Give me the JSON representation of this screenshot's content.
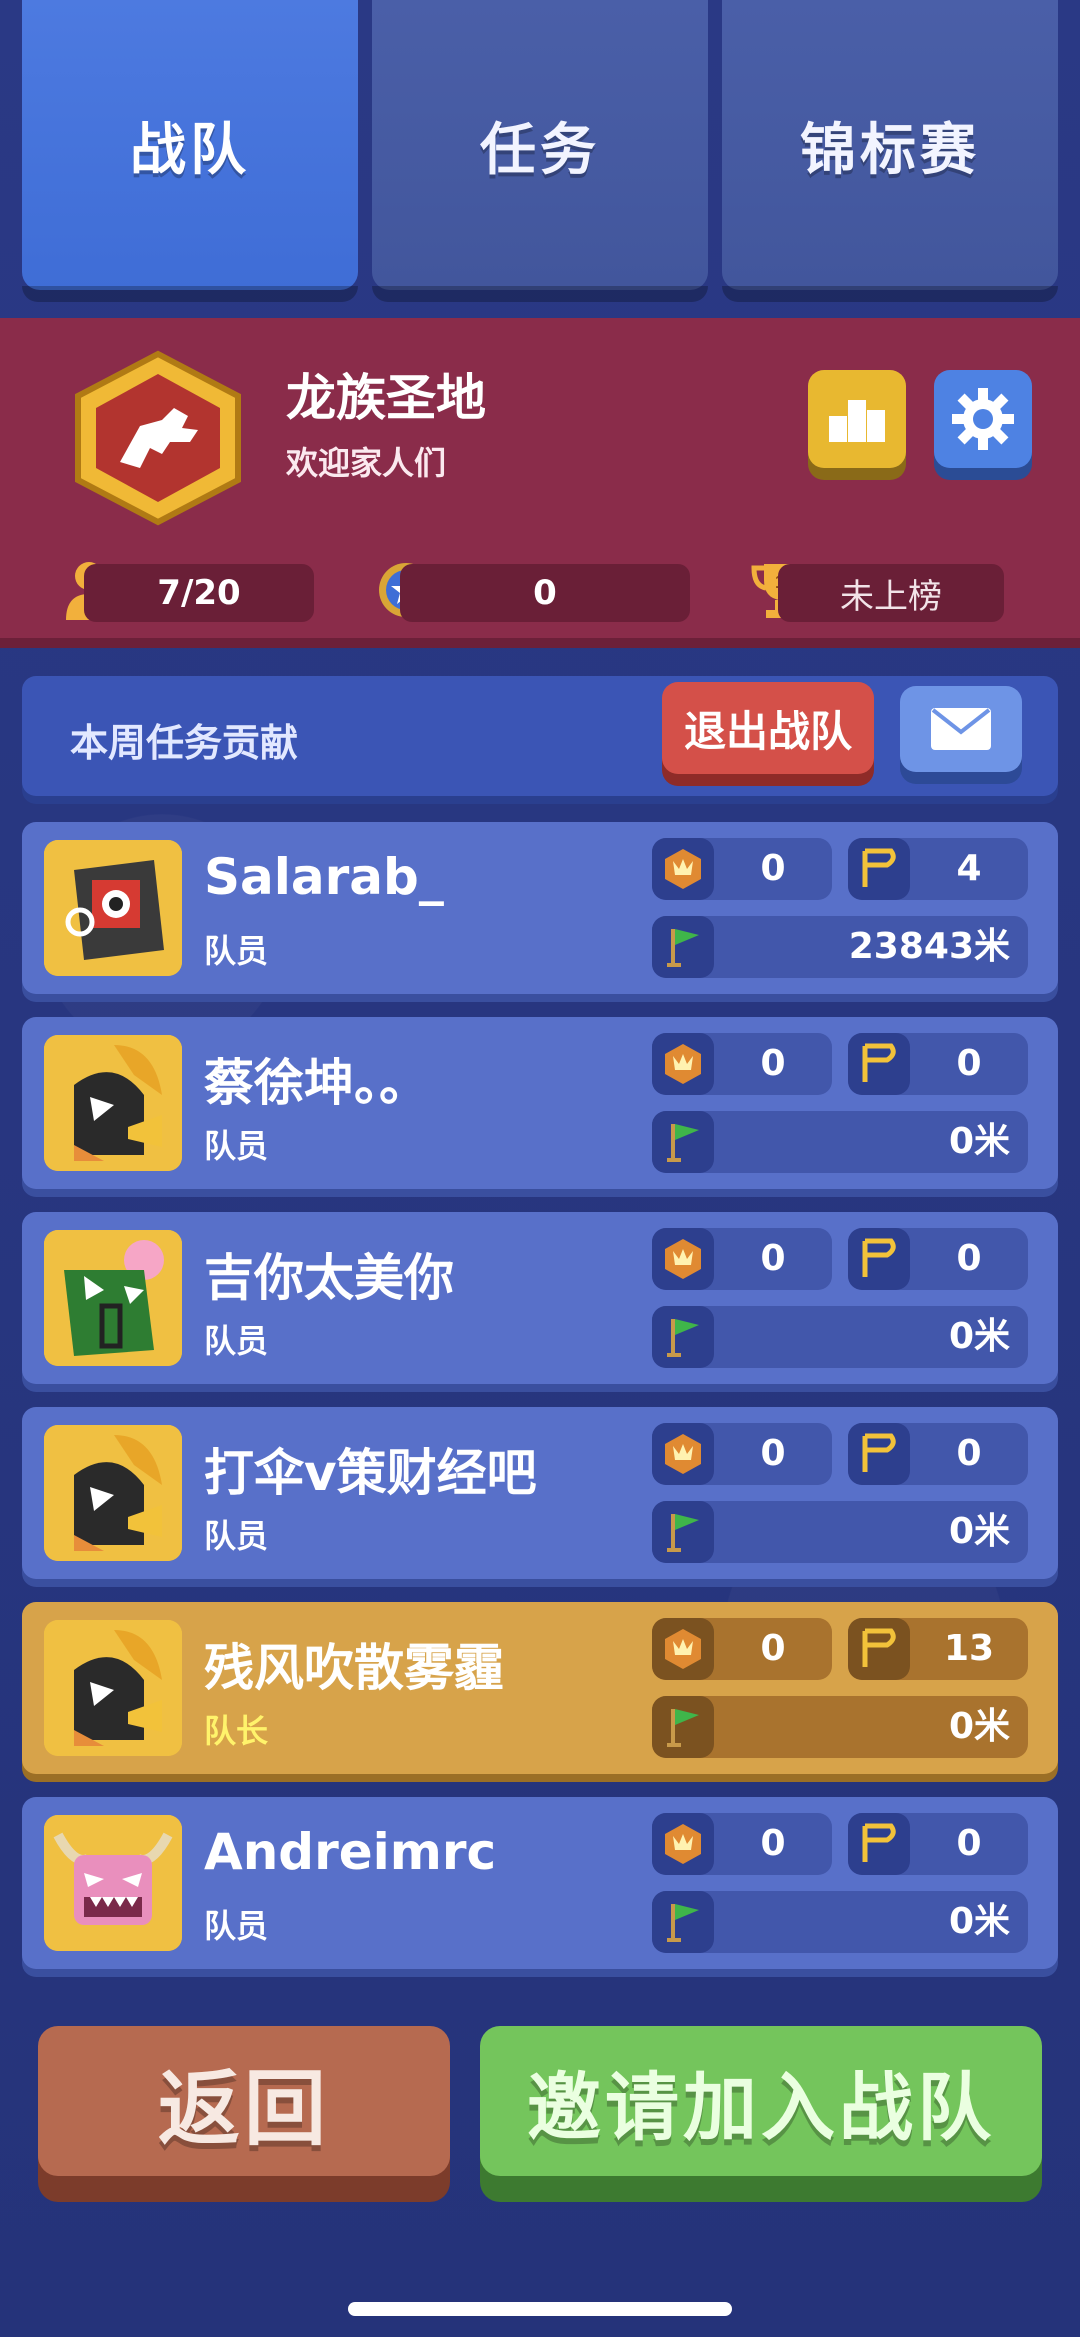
{
  "tabs": [
    {
      "label": "战队",
      "active": true
    },
    {
      "label": "任务",
      "active": false
    },
    {
      "label": "锦标赛",
      "active": false
    }
  ],
  "team": {
    "name": "龙族圣地",
    "motto": "欢迎家人们",
    "members": "7/20",
    "stars": "0",
    "rank": "未上榜"
  },
  "weekly": {
    "title": "本周任务贡献",
    "leave_label": "退出战队"
  },
  "members": [
    {
      "name": "Salarab_",
      "role": "队员",
      "trophies": "0",
      "flags": "4",
      "distance": "23843米",
      "captain": false,
      "avatar": "robot-red"
    },
    {
      "name": "蔡徐坤。。",
      "role": "队员",
      "trophies": "0",
      "flags": "0",
      "distance": "0米",
      "captain": false,
      "avatar": "penguin-horn"
    },
    {
      "name": "吉你太美你",
      "role": "队员",
      "trophies": "0",
      "flags": "0",
      "distance": "0米",
      "captain": false,
      "avatar": "green-monster"
    },
    {
      "name": "打伞v策财经吧",
      "role": "队员",
      "trophies": "0",
      "flags": "0",
      "distance": "0米",
      "captain": false,
      "avatar": "penguin-horn"
    },
    {
      "name": "残风吹散雾霾",
      "role": "队长",
      "trophies": "0",
      "flags": "13",
      "distance": "0米",
      "captain": true,
      "avatar": "penguin-horn"
    },
    {
      "name": "Andreimrc",
      "role": "队员",
      "trophies": "0",
      "flags": "0",
      "distance": "0米",
      "captain": false,
      "avatar": "pink-bull"
    }
  ],
  "buttons": {
    "back": "返回",
    "invite": "邀请加入战队"
  },
  "colors": {
    "background": "#27357a",
    "team_header": "#8a2c4a",
    "member_card": "#5870c9",
    "captain_card": "#d7a34a",
    "back_button": "#b66a50",
    "invite_button": "#74c55c"
  },
  "icons": [
    "team-badge-icon",
    "leaderboard-icon",
    "settings-gear-icon",
    "member-icon",
    "star-medal-icon",
    "trophy-icon",
    "mail-icon",
    "trophy-badge-icon",
    "golden-flag-icon",
    "green-flag-icon"
  ]
}
